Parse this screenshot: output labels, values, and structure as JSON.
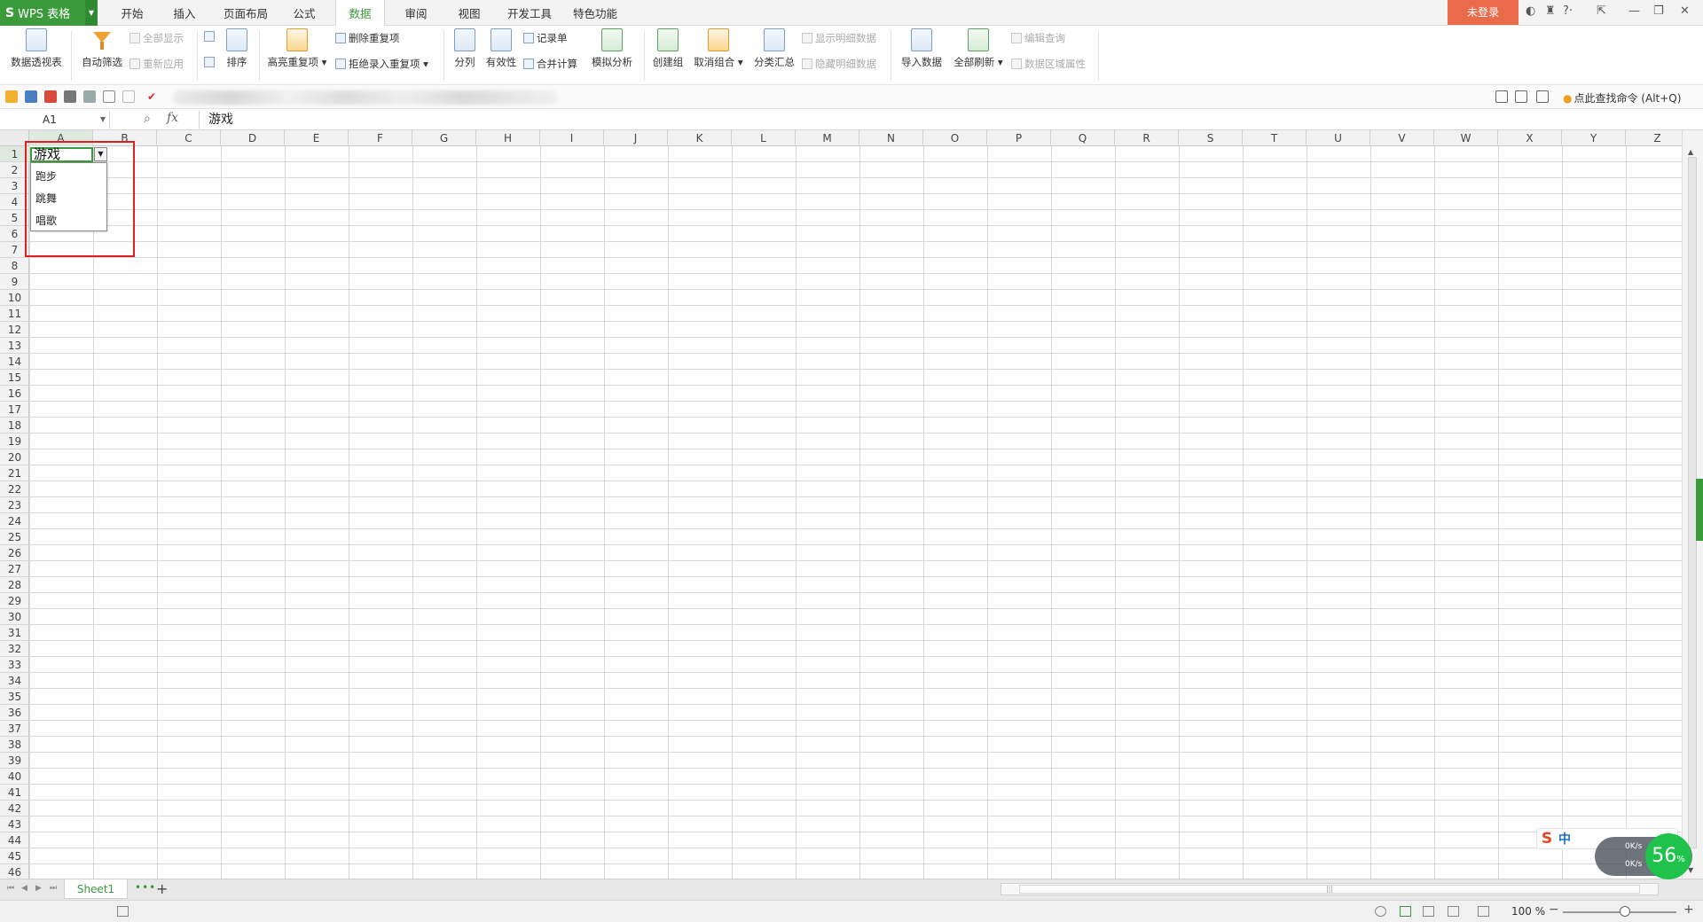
{
  "app": {
    "logo_letter": "S",
    "name": "WPS 表格"
  },
  "menu_tabs": [
    "开始",
    "插入",
    "页面布局",
    "公式",
    "数据",
    "审阅",
    "视图",
    "开发工具",
    "特色功能"
  ],
  "active_tab": "数据",
  "login_label": "未登录",
  "ribbon": {
    "pivot": "数据透视表",
    "autofilter": "自动筛选",
    "show_all": "全部显示",
    "reapply": "重新应用",
    "sort": "排序",
    "highlight_dup": "高亮重复项",
    "delete_dup": "删除重复项",
    "reject_dup": "拒绝录入重复项",
    "split": "分列",
    "validity": "有效性",
    "record": "记录单",
    "consolidate": "合并计算",
    "simulate": "模拟分析",
    "create_group": "创建组",
    "ungroup": "取消组合",
    "subtotal": "分类汇总",
    "show_detail": "显示明细数据",
    "hide_detail": "隐藏明细数据",
    "import_data": "导入数据",
    "refresh_all": "全部刷新",
    "edit_query": "编辑查询",
    "range_props": "数据区域属性"
  },
  "command_search": "点此查找命令 (Alt+Q)",
  "formula_bar": {
    "name_box": "A1",
    "fx": "fx",
    "content": "游戏"
  },
  "columns": [
    "A",
    "B",
    "C",
    "D",
    "E",
    "F",
    "G",
    "H",
    "I",
    "J",
    "K",
    "L",
    "M",
    "N",
    "O",
    "P",
    "Q",
    "R",
    "S",
    "T",
    "U",
    "V",
    "W",
    "X",
    "Y",
    "Z"
  ],
  "rows": [
    "1",
    "2",
    "3",
    "4",
    "5",
    "6",
    "7",
    "8",
    "9",
    "10",
    "11",
    "12",
    "13",
    "14",
    "15",
    "16",
    "17",
    "18",
    "19",
    "20",
    "21",
    "22",
    "23",
    "24",
    "25",
    "26",
    "27",
    "28",
    "29",
    "30",
    "31",
    "32",
    "33",
    "34",
    "35",
    "36",
    "37",
    "38",
    "39",
    "40",
    "41",
    "42",
    "43",
    "44",
    "45",
    "46"
  ],
  "cell_a1": "游戏",
  "dropdown_items": [
    "跑步",
    "跳舞",
    "唱歌"
  ],
  "sheet_tab": "Sheet1",
  "more_sheets": "•••",
  "zoom": "100 %",
  "ime": {
    "logo": "S",
    "mode": "中"
  },
  "net": {
    "up": "0K/s",
    "down": "0K/s",
    "percent": "56",
    "percent_unit": "%"
  },
  "colors": {
    "accent": "#3a9a3c",
    "login": "#e96b4a",
    "highlight": "#e02020"
  }
}
